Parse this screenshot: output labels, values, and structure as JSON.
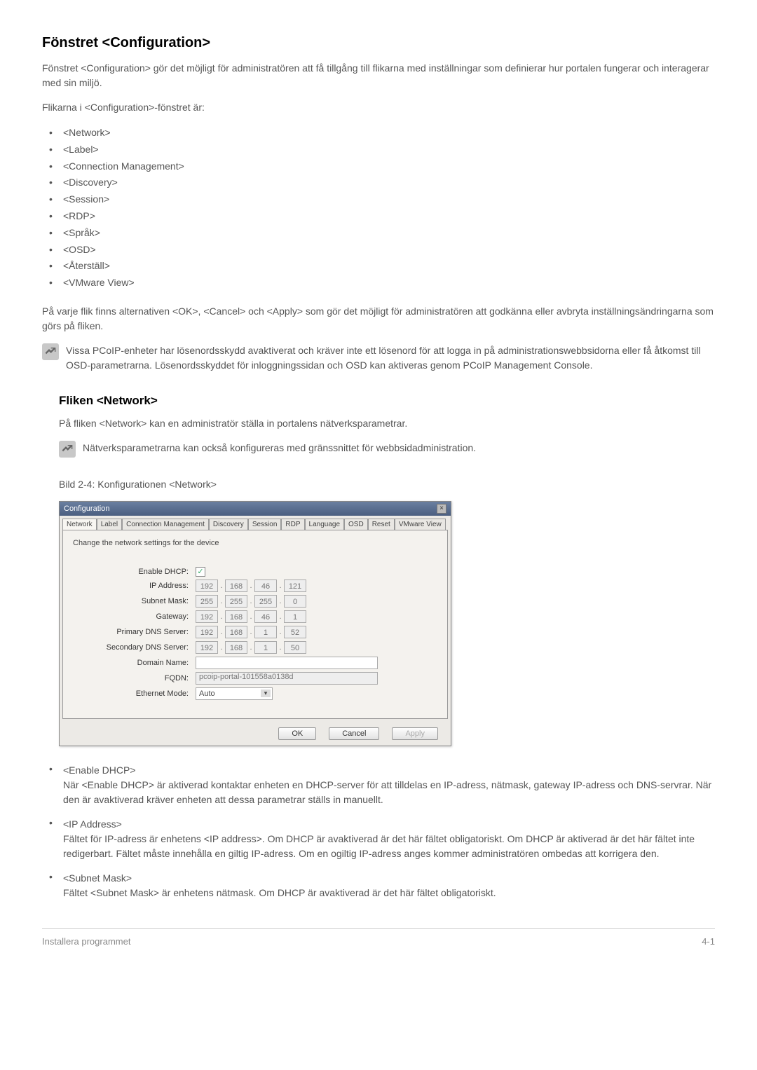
{
  "headings": {
    "main": "Fönstret <Configuration>",
    "network": "Fliken <Network>"
  },
  "paras": {
    "intro": "Fönstret <Configuration> gör det möjligt för administratören att få tillgång till flikarna med inställningar som definierar hur portalen fungerar och interagerar med sin miljö.",
    "tabs_intro": "Flikarna i <Configuration>-fönstret är:",
    "after_list": "På varje flik finns alternativen <OK>, <Cancel> och <Apply> som gör det möjligt för administratören att godkänna eller avbryta inställningsändringarna som görs på fliken.",
    "note1": "Vissa PCoIP-enheter har lösenordsskydd avaktiverat och kräver inte ett lösenord för att logga in på administrationswebbsidorna eller få åtkomst till OSD-parametrarna. Lösenordsskyddet för inloggningssidan och OSD kan aktiveras genom PCoIP Management Console.",
    "network_intro": "På fliken <Network> kan en administratör ställa in portalens nätverksparametrar.",
    "note2": "Nätverksparametrarna kan också konfigureras med gränssnittet för webbsidadministration.",
    "caption": "Bild 2-4: Konfigurationen <Network>"
  },
  "tab_list": [
    "<Network>",
    "<Label>",
    "<Connection Management>",
    "<Discovery>",
    "<Session>",
    "<RDP>",
    "<Språk>",
    "<OSD>",
    "<Återställ>",
    "<VMware View>"
  ],
  "window": {
    "title": "Configuration",
    "tabs": [
      "Network",
      "Label",
      "Connection Management",
      "Discovery",
      "Session",
      "RDP",
      "Language",
      "OSD",
      "Reset",
      "VMware View"
    ],
    "panel_desc": "Change the network settings for the device",
    "labels": {
      "dhcp": "Enable DHCP:",
      "ip": "IP Address:",
      "subnet": "Subnet Mask:",
      "gateway": "Gateway:",
      "pdns": "Primary DNS Server:",
      "sdns": "Secondary DNS Server:",
      "domain": "Domain Name:",
      "fqdn": "FQDN:",
      "ethernet": "Ethernet Mode:"
    },
    "values": {
      "dhcp_checked": "✓",
      "ip": [
        "192",
        "168",
        "46",
        "121"
      ],
      "subnet": [
        "255",
        "255",
        "255",
        "0"
      ],
      "gateway": [
        "192",
        "168",
        "46",
        "1"
      ],
      "pdns": [
        "192",
        "168",
        "1",
        "52"
      ],
      "sdns": [
        "192",
        "168",
        "1",
        "50"
      ],
      "domain": "",
      "fqdn": "pcoip-portal-101558a0138d",
      "ethernet": "Auto"
    },
    "buttons": {
      "ok": "OK",
      "cancel": "Cancel",
      "apply": "Apply"
    }
  },
  "defs": [
    {
      "term": "<Enable DHCP>",
      "body": "När <Enable DHCP> är aktiverad kontaktar enheten en DHCP-server för att tilldelas en IP-adress, nätmask, gateway IP-adress och DNS-servrar. När den är avaktiverad kräver enheten att dessa parametrar ställs in manuellt."
    },
    {
      "term": "<IP Address>",
      "body": "Fältet för IP-adress är enhetens <IP address>. Om DHCP är avaktiverad är det här fältet obligatoriskt. Om DHCP är aktiverad är det här fältet inte redigerbart. Fältet måste innehålla en giltig IP-adress. Om en ogiltig IP-adress anges kommer administratören ombedas att korrigera den."
    },
    {
      "term": "<Subnet Mask>",
      "body": "Fältet <Subnet Mask> är enhetens nätmask. Om DHCP är avaktiverad är det här fältet obligatoriskt."
    }
  ],
  "footer": {
    "left": "Installera programmet",
    "right": "4-1"
  }
}
